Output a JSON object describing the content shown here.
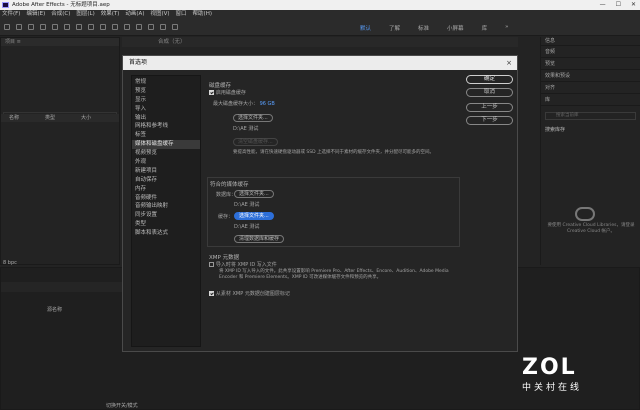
{
  "window": {
    "title": "Adobe After Effects - 无标题项目.aep",
    "controls": [
      "—",
      "☐",
      "✕"
    ]
  },
  "menubar": [
    "文件(F)",
    "编辑(E)",
    "合成(C)",
    "图层(L)",
    "效果(T)",
    "动画(A)",
    "视图(V)",
    "窗口",
    "帮助(H)"
  ],
  "workspaces": [
    "默认",
    "了解",
    "标准",
    "小屏幕",
    "库",
    "»"
  ],
  "left_panels": {
    "project_header": "项目 ≡",
    "comp_header": "合成（无）",
    "column_name": "名称",
    "column_type": "类型",
    "column_size": "大小",
    "bpc_label": "8 bpc",
    "timeline_header": "",
    "layer_name_col": "源名称",
    "toggle_switch_label": "切换开关/模式"
  },
  "right_panels": {
    "items": [
      "信息",
      "音频",
      "预览",
      "效果和预设",
      "对齐",
      "库"
    ],
    "search_placeholder": "搜索当前库",
    "library_title": "搜索库存",
    "library_message": "要使用 Creative Cloud Libraries，请登录 Creative Cloud 帐户。"
  },
  "dialog": {
    "title": "首选项",
    "close_icon": "×",
    "categories": [
      "常规",
      "预览",
      "显示",
      "导入",
      "输出",
      "网格和参考线",
      "标签",
      "媒体和磁盘缓存",
      "视频预览",
      "外观",
      "新建项目",
      "自动保存",
      "内存",
      "音频硬件",
      "音频输出映射",
      "同步设置",
      "类型",
      "脚本和表达式"
    ],
    "selected_category": "媒体和磁盘缓存",
    "disk_cache": {
      "title": "磁盘缓存",
      "enable_label": "启用磁盘缓存",
      "enabled": true,
      "max_size_label": "最大磁盘缓存大小：",
      "max_size_value": "96 GB",
      "choose_folder": "选择文件夹...",
      "path": "D:\\AE 测试",
      "empty_cache": "清空磁盘缓存...",
      "note": "要提高性能，请在快速硬盘驱动器或 SSD 上选择不同于素材的缓存文件夹，并分配尽可能多的空间。"
    },
    "conformed_cache": {
      "title": "符合的媒体缓存",
      "database_label": "数据库：",
      "database_btn": "选择文件夹...",
      "database_path": "D:\\AE 测试",
      "cache_label": "缓存：",
      "cache_btn": "选择文件夹...",
      "cache_path": "D:\\AE 测试",
      "clean_btn": "清理数据库和缓存"
    },
    "xmp": {
      "title": "XMP 元数据",
      "import_label": "导入时将 XMP ID 写入文件",
      "import_checked": false,
      "import_note": "将 XMP ID 写入导入的文件。此共享设置影响 Premiere Pro、After Effects、Encore、Audition、Adobe Media Encoder 和 Premiere Elements。XMP ID 可改进媒体缓存文件和预览的共享。",
      "create_label": "从素材 XMP 元数据创建图层标记",
      "create_checked": true
    },
    "buttons": {
      "ok": "确定",
      "cancel": "取消",
      "prev": "上一步",
      "next": "下一步"
    }
  },
  "watermark": {
    "logo": "ZOL",
    "sub": "中关村在线"
  }
}
